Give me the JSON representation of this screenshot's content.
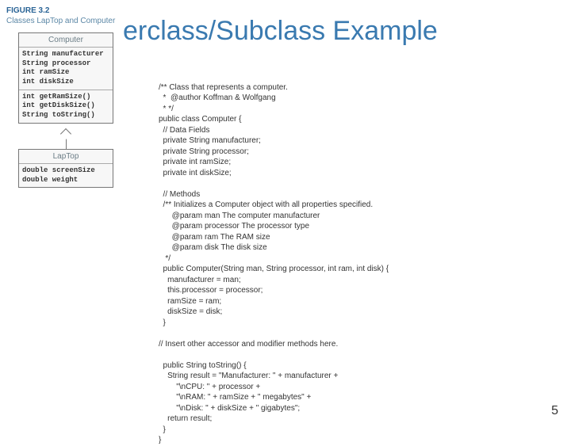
{
  "title": "erclass/Subclass Example",
  "figure": {
    "label": "FIGURE 3.2",
    "caption": "Classes LapTop and Computer"
  },
  "uml": {
    "computer": {
      "name": "Computer",
      "fields": "String manufacturer\nString processor\nint ramSize\nint diskSize",
      "methods": "int getRamSize()\nint getDiskSize()\nString toString()"
    },
    "laptop": {
      "name": "LapTop",
      "fields": "double screenSize\ndouble weight"
    }
  },
  "code": {
    "block1": "/** Class that represents a computer.\n  *  @author Koffman & Wolfgang\n  * */\npublic class Computer {\n  // Data Fields\n  private String manufacturer;\n  private String processor;\n  private int ramSize;\n  private int diskSize;",
    "block2": "  // Methods\n  /** Initializes a Computer object with all properties specified.\n      @param man The computer manufacturer\n      @param processor The processor type\n      @param ram The RAM size\n      @param disk The disk size\n   */\n  public Computer(String man, String processor, int ram, int disk) {\n    manufacturer = man;\n    this.processor = processor;\n    ramSize = ram;\n    diskSize = disk;\n  }",
    "block3": "// Insert other accessor and modifier methods here.",
    "block4": "  public String toString() {\n    String result = \"Manufacturer: \" + manufacturer +\n        \"\\nCPU: \" + processor +\n        \"\\nRAM: \" + ramSize + \" megabytes\" +\n        \"\\nDisk: \" + diskSize + \" gigabytes\";\n    return result;\n  }\n}"
  },
  "page_number": "5"
}
